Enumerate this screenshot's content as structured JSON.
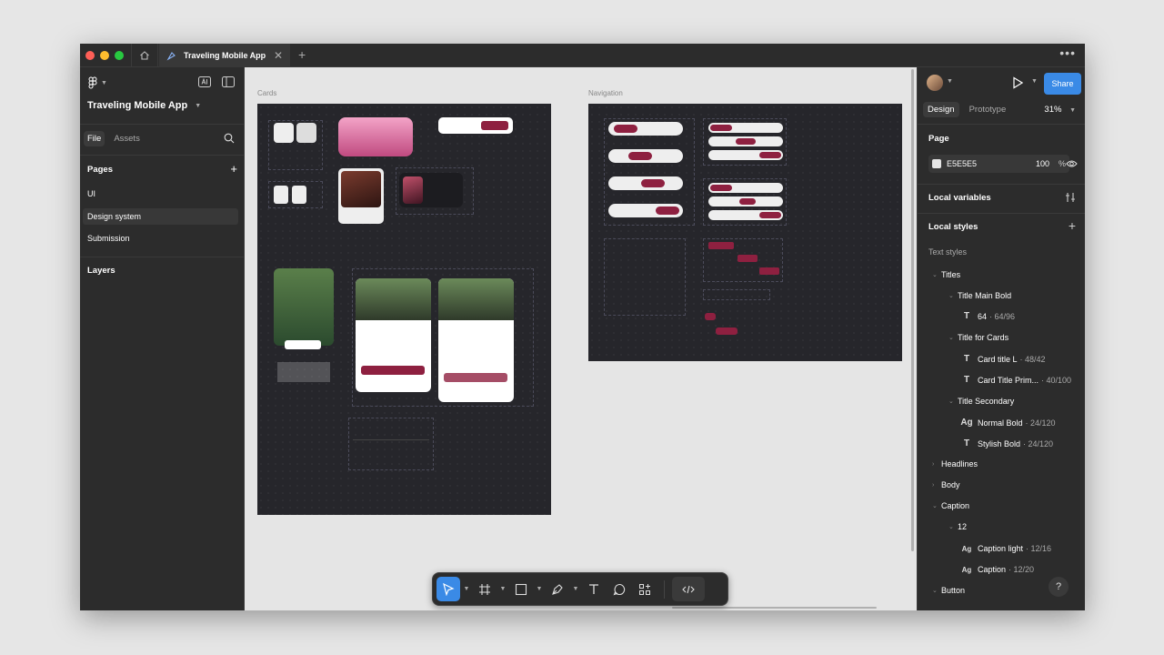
{
  "tab": {
    "title": "Traveling Mobile App"
  },
  "left_panel": {
    "project_name": "Traveling Mobile App",
    "tabs": [
      "File",
      "Assets"
    ],
    "pages_label": "Pages",
    "pages": [
      "UI",
      "Design system",
      "Submission"
    ],
    "layers_label": "Layers"
  },
  "canvas": {
    "frames": [
      "Cards",
      "Navigation"
    ]
  },
  "right_panel": {
    "share_label": "Share",
    "tabs": [
      "Design",
      "Prototype"
    ],
    "zoom": "31%",
    "page_label": "Page",
    "page_color": "E5E5E5",
    "page_opacity": "100",
    "page_opacity_unit": "%",
    "local_variables": "Local variables",
    "local_styles": "Local styles",
    "text_styles": "Text styles",
    "tree": {
      "titles": "Titles",
      "title_main_bold": "Title Main Bold",
      "s64_name": "64",
      "s64_meta": "· 64/96",
      "title_for_cards": "Title for Cards",
      "card_title_l_name": "Card title L",
      "card_title_l_meta": "· 48/42",
      "card_title_prim_name": "Card Title Prim...",
      "card_title_prim_meta": "· 40/100",
      "title_secondary": "Title Secondary",
      "normal_bold_name": "Normal Bold",
      "normal_bold_meta": "· 24/120",
      "stylish_bold_name": "Stylish Bold",
      "stylish_bold_meta": "· 24/120",
      "headlines": "Headlines",
      "body": "Body",
      "caption": "Caption",
      "s12": "12",
      "caption_light_name": "Caption light",
      "caption_light_meta": "· 12/16",
      "caption_name": "Caption",
      "caption_meta": "· 12/20",
      "button": "Button"
    }
  },
  "colors": {
    "accent": "#3a8ae6",
    "brand": "#8e2040",
    "page_bg": "#e5e5e5"
  }
}
